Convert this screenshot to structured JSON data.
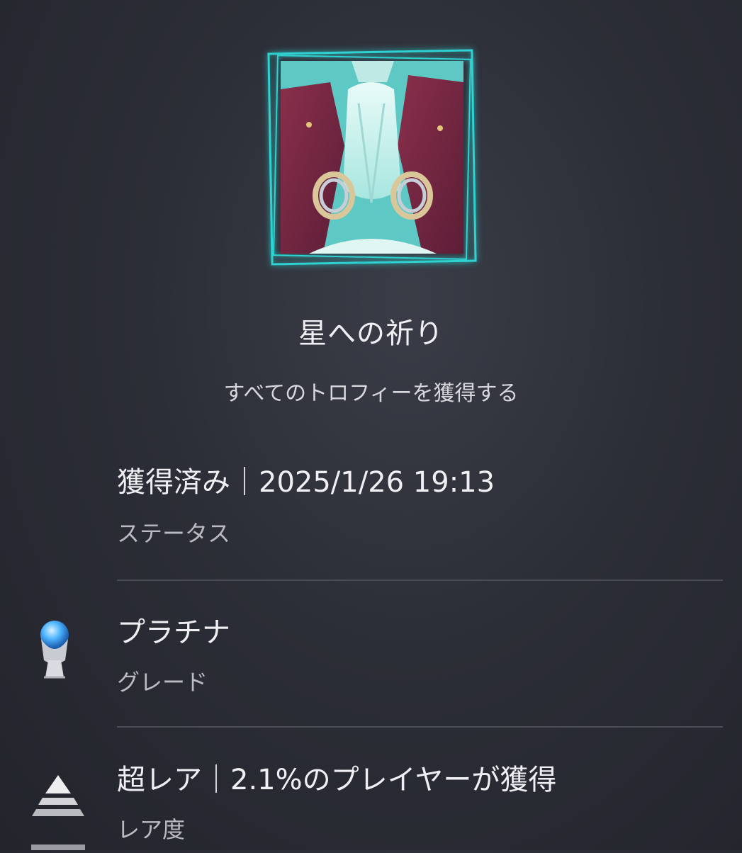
{
  "trophy": {
    "icon": "trophy-art-image",
    "title": "星への祈り",
    "description": "すべてのトロフィーを獲得する",
    "frame_color": "#2fd3d2"
  },
  "status": {
    "value": "獲得済み｜2025/1/26  19:13",
    "label": "ステータス"
  },
  "grade": {
    "value": "プラチナ",
    "label": "グレード",
    "icon": "platinum-trophy-icon",
    "icon_color": "#4fb6ff"
  },
  "rarity": {
    "value": "超レア｜2.1%のプレイヤーが獲得",
    "label": "レア度",
    "icon": "rarity-pyramid-icon"
  },
  "colors": {
    "background": "#2c2e37",
    "divider": "#4a4c56"
  }
}
